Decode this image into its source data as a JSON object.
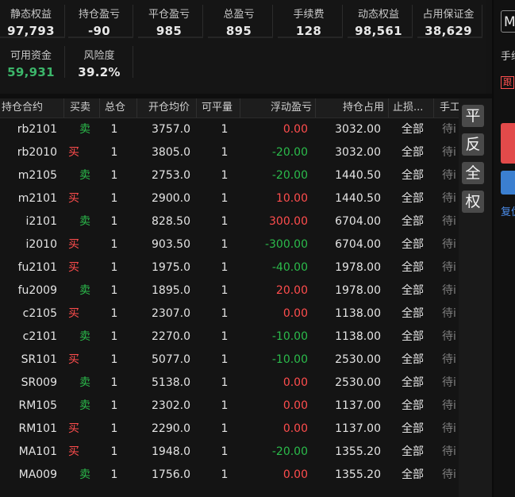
{
  "summary": {
    "row1": [
      {
        "label": "静态权益",
        "value": "97,793"
      },
      {
        "label": "持仓盈亏",
        "value": "-90"
      },
      {
        "label": "平仓盈亏",
        "value": "985"
      },
      {
        "label": "总盈亏",
        "value": "895"
      },
      {
        "label": "手续费",
        "value": "128"
      },
      {
        "label": "动态权益",
        "value": "98,561"
      },
      {
        "label": "占用保证金",
        "value": "38,629"
      }
    ],
    "row2": [
      {
        "label": "可用资金",
        "value": "59,931",
        "color": "#3cb66a"
      },
      {
        "label": "风险度",
        "value": "39.2%"
      }
    ]
  },
  "table": {
    "headers": {
      "symbol": "持仓合约",
      "side": "买卖",
      "qty": "总仓",
      "avg": "开仓均价",
      "avail": "可平量",
      "pnl": "浮动盈亏",
      "margin": "持仓占用",
      "stop": "止损...",
      "manual": "手工"
    },
    "rows": [
      {
        "symbol": "rb2101",
        "side": "卖",
        "side_type": "sell",
        "qty": "1",
        "avg": "3757.0",
        "avail": "1",
        "pnl": "0.00",
        "pnl_color": "red",
        "margin": "3032.00",
        "stop": "全部",
        "manual": "待i"
      },
      {
        "symbol": "rb2010",
        "side": "买",
        "side_type": "buy",
        "qty": "1",
        "avg": "3805.0",
        "avail": "1",
        "pnl": "-20.00",
        "pnl_color": "green",
        "margin": "3032.00",
        "stop": "全部",
        "manual": "待i"
      },
      {
        "symbol": "m2105",
        "side": "卖",
        "side_type": "sell",
        "qty": "1",
        "avg": "2753.0",
        "avail": "1",
        "pnl": "-20.00",
        "pnl_color": "green",
        "margin": "1440.50",
        "stop": "全部",
        "manual": "待i"
      },
      {
        "symbol": "m2101",
        "side": "买",
        "side_type": "buy",
        "qty": "1",
        "avg": "2900.0",
        "avail": "1",
        "pnl": "10.00",
        "pnl_color": "red",
        "margin": "1440.50",
        "stop": "全部",
        "manual": "待i"
      },
      {
        "symbol": "i2101",
        "side": "卖",
        "side_type": "sell",
        "qty": "1",
        "avg": "828.50",
        "avail": "1",
        "pnl": "300.00",
        "pnl_color": "red",
        "margin": "6704.00",
        "stop": "全部",
        "manual": "待i"
      },
      {
        "symbol": "i2010",
        "side": "买",
        "side_type": "buy",
        "qty": "1",
        "avg": "903.50",
        "avail": "1",
        "pnl": "-300.00",
        "pnl_color": "green",
        "margin": "6704.00",
        "stop": "全部",
        "manual": "待i"
      },
      {
        "symbol": "fu2101",
        "side": "买",
        "side_type": "buy",
        "qty": "1",
        "avg": "1975.0",
        "avail": "1",
        "pnl": "-40.00",
        "pnl_color": "green",
        "margin": "1978.00",
        "stop": "全部",
        "manual": "待i"
      },
      {
        "symbol": "fu2009",
        "side": "卖",
        "side_type": "sell",
        "qty": "1",
        "avg": "1895.0",
        "avail": "1",
        "pnl": "20.00",
        "pnl_color": "red",
        "margin": "1978.00",
        "stop": "全部",
        "manual": "待i"
      },
      {
        "symbol": "c2105",
        "side": "买",
        "side_type": "buy",
        "qty": "1",
        "avg": "2307.0",
        "avail": "1",
        "pnl": "0.00",
        "pnl_color": "red",
        "margin": "1138.00",
        "stop": "全部",
        "manual": "待i"
      },
      {
        "symbol": "c2101",
        "side": "卖",
        "side_type": "sell",
        "qty": "1",
        "avg": "2270.0",
        "avail": "1",
        "pnl": "-10.00",
        "pnl_color": "green",
        "margin": "1138.00",
        "stop": "全部",
        "manual": "待i"
      },
      {
        "symbol": "SR101",
        "side": "买",
        "side_type": "buy",
        "qty": "1",
        "avg": "5077.0",
        "avail": "1",
        "pnl": "-10.00",
        "pnl_color": "green",
        "margin": "2530.00",
        "stop": "全部",
        "manual": "待i"
      },
      {
        "symbol": "SR009",
        "side": "卖",
        "side_type": "sell",
        "qty": "1",
        "avg": "5138.0",
        "avail": "1",
        "pnl": "0.00",
        "pnl_color": "red",
        "margin": "2530.00",
        "stop": "全部",
        "manual": "待i"
      },
      {
        "symbol": "RM105",
        "side": "卖",
        "side_type": "sell",
        "qty": "1",
        "avg": "2302.0",
        "avail": "1",
        "pnl": "0.00",
        "pnl_color": "red",
        "margin": "1137.00",
        "stop": "全部",
        "manual": "待i"
      },
      {
        "symbol": "RM101",
        "side": "买",
        "side_type": "buy",
        "qty": "1",
        "avg": "2290.0",
        "avail": "1",
        "pnl": "0.00",
        "pnl_color": "red",
        "margin": "1137.00",
        "stop": "全部",
        "manual": "待i"
      },
      {
        "symbol": "MA101",
        "side": "买",
        "side_type": "buy",
        "qty": "1",
        "avg": "1948.0",
        "avail": "1",
        "pnl": "-20.00",
        "pnl_color": "green",
        "margin": "1355.20",
        "stop": "全部",
        "manual": "待i"
      },
      {
        "symbol": "MA009",
        "side": "卖",
        "side_type": "sell",
        "qty": "1",
        "avg": "1756.0",
        "avail": "1",
        "pnl": "0.00",
        "pnl_color": "red",
        "margin": "1355.20",
        "stop": "全部",
        "manual": "待i"
      }
    ]
  },
  "quick_buttons": [
    {
      "label": "平"
    },
    {
      "label": "反"
    },
    {
      "label": "全"
    },
    {
      "label": "权"
    }
  ],
  "right_panel": {
    "select_value": "M",
    "fee_label": "手续",
    "follow_label": "跟",
    "copy_label": "复仇"
  }
}
